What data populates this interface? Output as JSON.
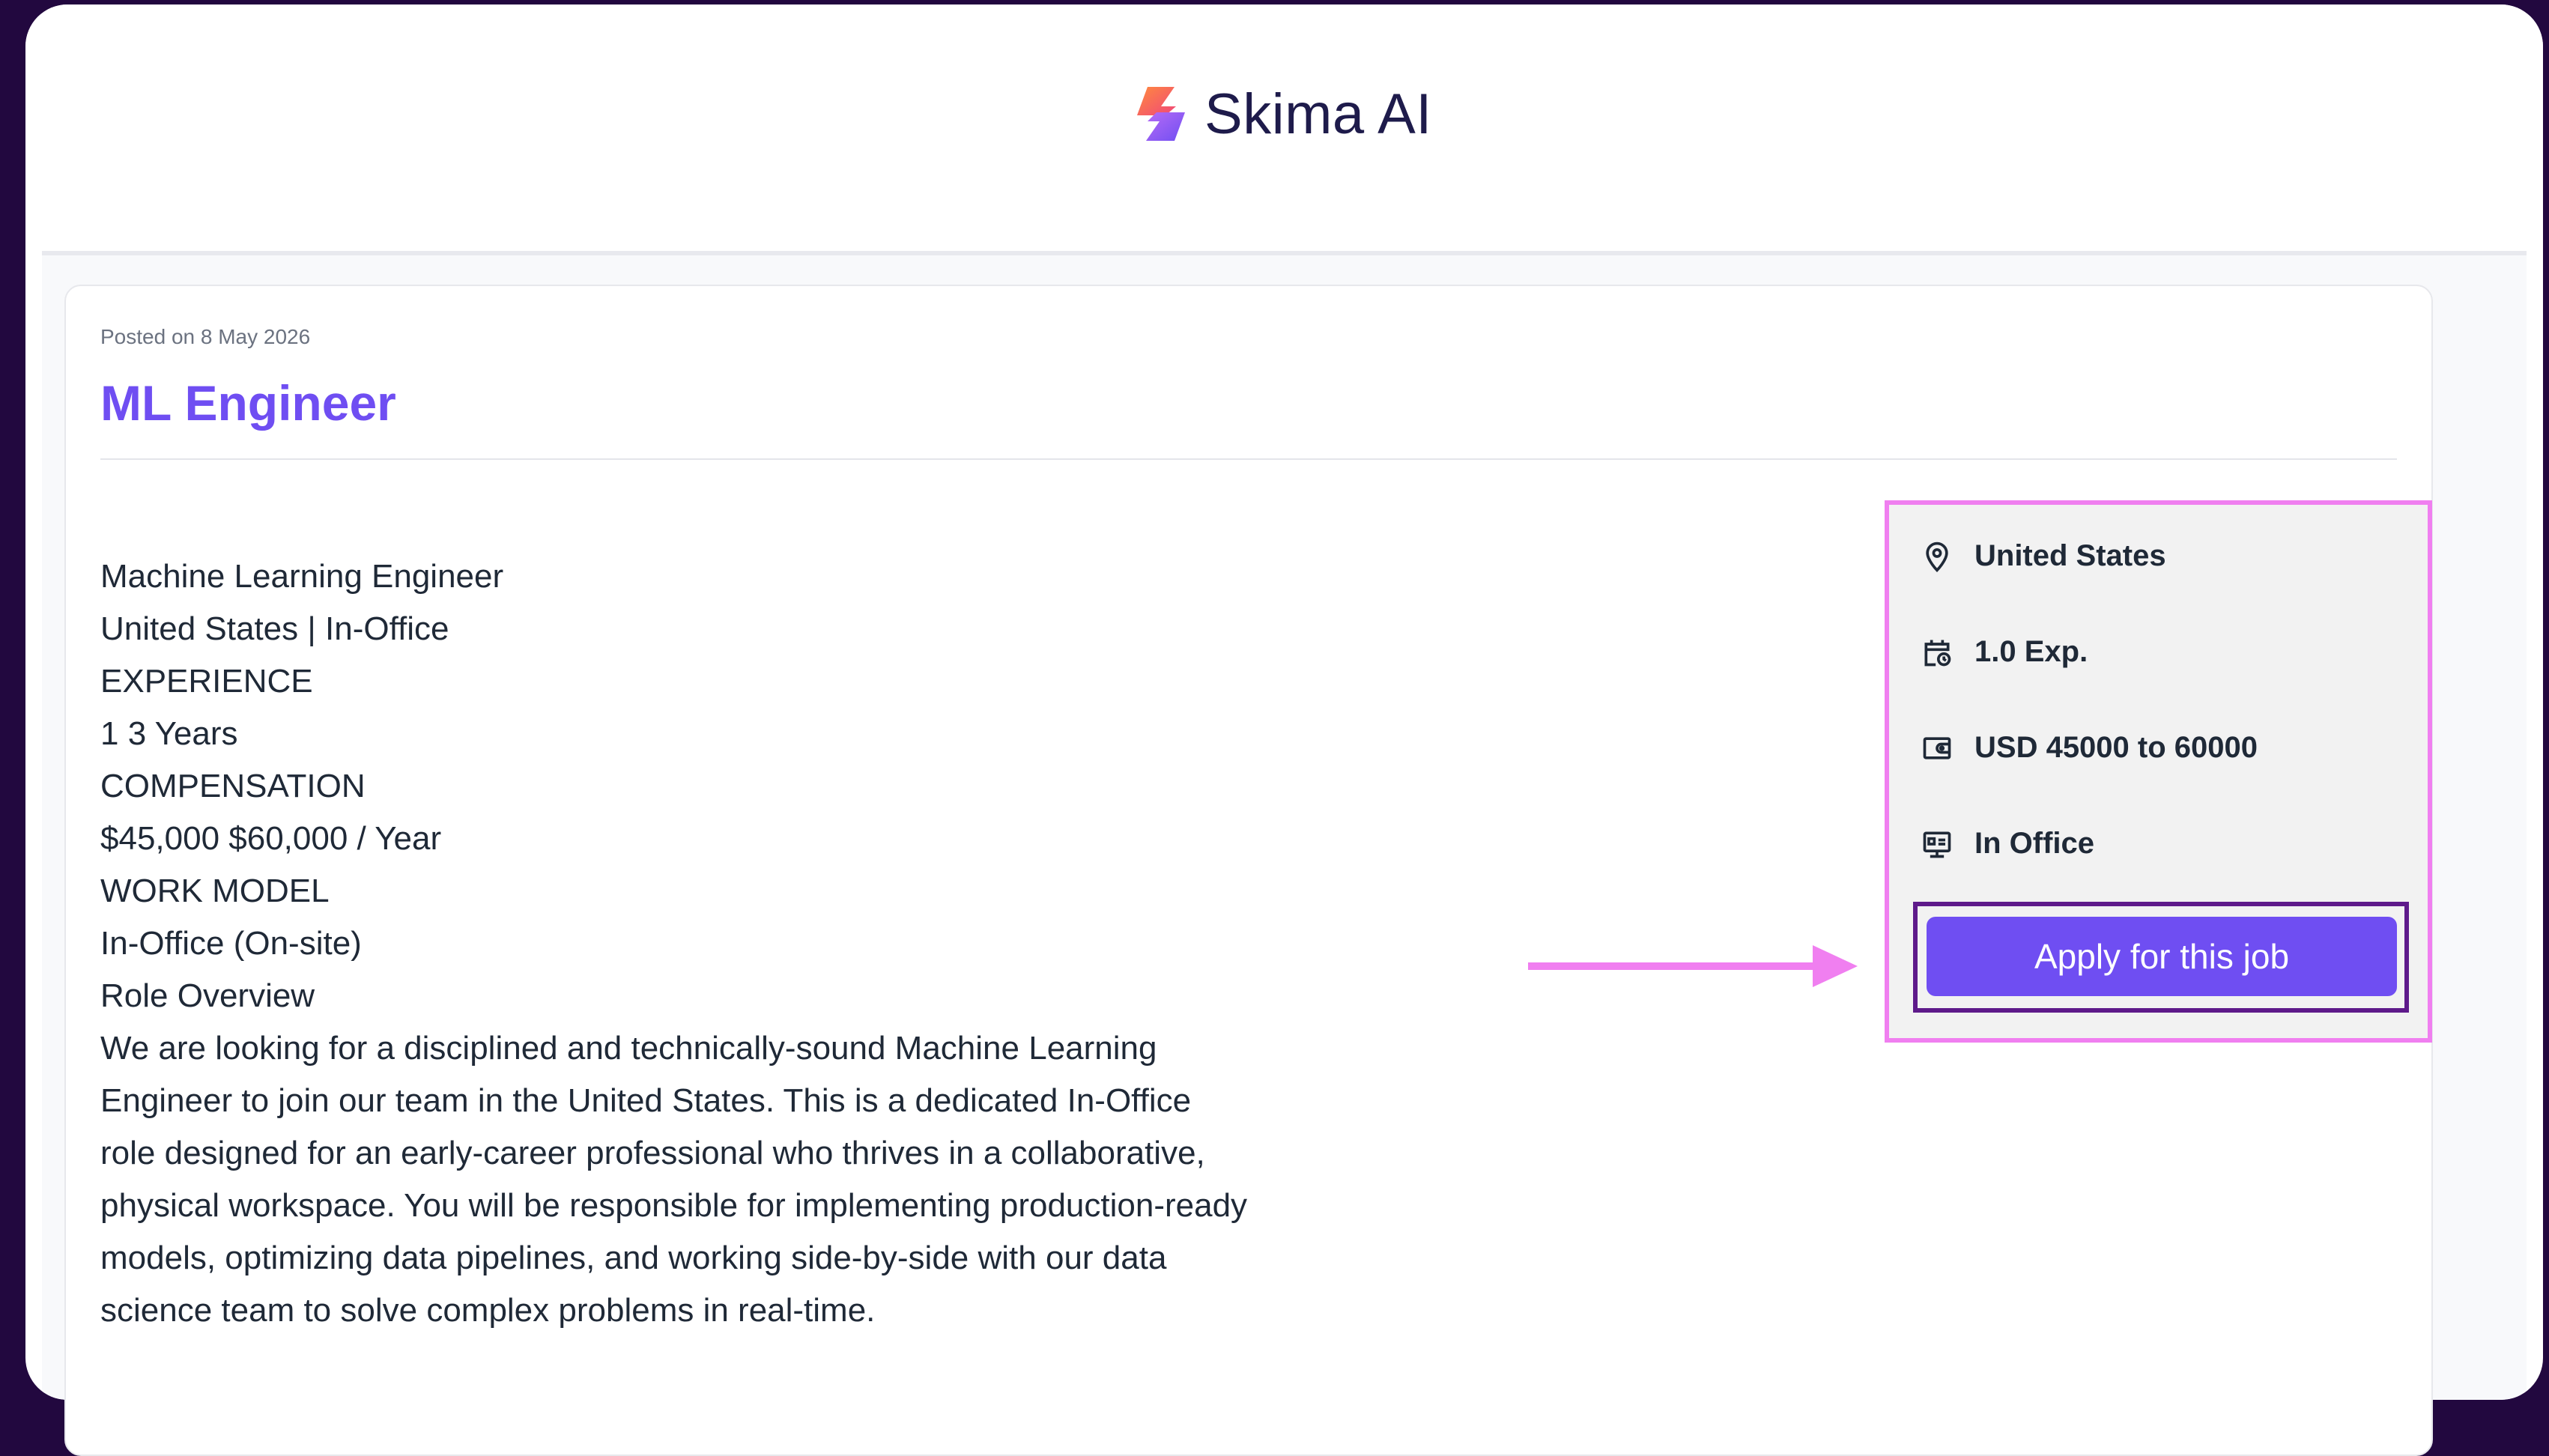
{
  "header": {
    "logo_text": "Skima AI"
  },
  "job": {
    "posted": "Posted on 8 May 2026",
    "title": "ML Engineer",
    "description": [
      "Machine Learning Engineer",
      "United States | In-Office",
      "EXPERIENCE",
      "1 3 Years",
      "COMPENSATION",
      "$45,000 $60,000 / Year",
      "WORK MODEL",
      "In-Office (On-site)",
      "Role Overview",
      "We are looking for a disciplined and technically-sound Machine Learning",
      "Engineer to join our team in the United States. This is a dedicated In-Office",
      "role designed for an early-career professional who thrives in a collaborative,",
      "physical workspace. You will be responsible for implementing production-ready",
      "models, optimizing data pipelines, and working side-by-side with our data",
      "science team to solve complex problems in real-time."
    ]
  },
  "summary": {
    "location": "United States",
    "experience": "1.0 Exp.",
    "salary": "USD 45000 to 60000",
    "work_model": "In Office",
    "apply_label": "Apply for this job",
    "icons": [
      "location-pin-icon",
      "calendar-clock-icon",
      "wallet-icon",
      "office-icon"
    ]
  },
  "colors": {
    "accent": "#6f4ef2",
    "highlight_box": "#f07ff0",
    "apply_outline": "#5e1a8a",
    "frame_bg": "#22083f"
  }
}
